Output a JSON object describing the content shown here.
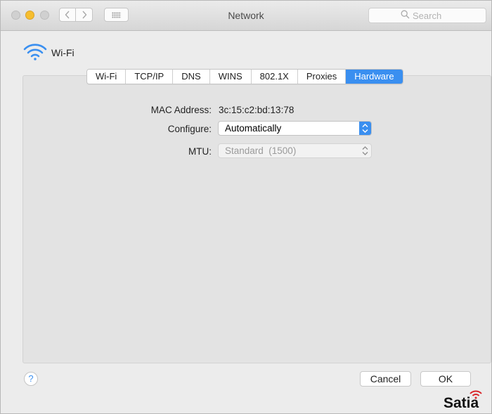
{
  "window": {
    "title": "Network",
    "search_placeholder": "Search"
  },
  "header": {
    "interface_name": "Wi-Fi"
  },
  "tabs": [
    {
      "label": "Wi-Fi"
    },
    {
      "label": "TCP/IP"
    },
    {
      "label": "DNS"
    },
    {
      "label": "WINS"
    },
    {
      "label": "802.1X"
    },
    {
      "label": "Proxies"
    },
    {
      "label": "Hardware",
      "active": true
    }
  ],
  "hardware": {
    "mac_label": "MAC Address:",
    "mac_value": "3c:15:c2:bd:13:78",
    "configure_label": "Configure:",
    "configure_value": "Automatically",
    "mtu_label": "MTU:",
    "mtu_value": "Standard  (1500)"
  },
  "footer": {
    "help_label": "?",
    "cancel_label": "Cancel",
    "ok_label": "OK"
  },
  "watermark": {
    "text": "Satia"
  },
  "colors": {
    "accent": "#3a8ff0",
    "minimize": "#f6be2f",
    "watermark_icon": "#d9262a"
  },
  "icons": {
    "back": "chevron-left-icon",
    "forward": "chevron-right-icon",
    "grid": "grid-icon",
    "search": "magnifier-icon",
    "wifi": "wifi-icon"
  }
}
